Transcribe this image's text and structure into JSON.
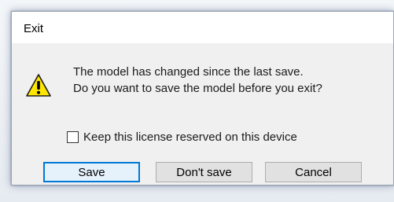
{
  "dialog": {
    "title": "Exit",
    "icon": "warning-icon",
    "message_line1": "The model has changed since the last save.",
    "message_line2": "Do you want to save the model before you exit?",
    "checkbox": {
      "label": "Keep this license reserved on this device",
      "checked": false
    },
    "buttons": {
      "save": "Save",
      "dont_save": "Don't save",
      "cancel": "Cancel"
    }
  },
  "colors": {
    "accent": "#0078d7",
    "warning_fill": "#ffe600",
    "button_face": "#e1e1e1",
    "dialog_body": "#f0f0f0"
  }
}
